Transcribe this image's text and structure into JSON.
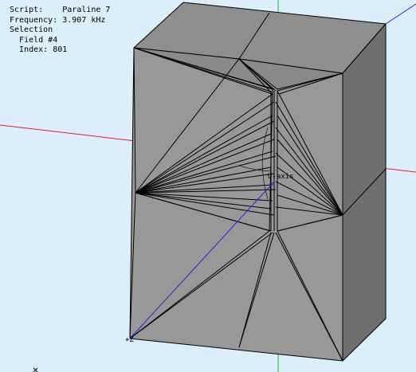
{
  "info": {
    "script_label": "Script:",
    "script_value": "Paraline 7",
    "frequency_label": "Frequency:",
    "frequency_value": "3.907 kHz",
    "selection_label": "Selection",
    "field_label": "Field #4",
    "index_label": "Index:",
    "index_value": "801"
  },
  "viewport": {
    "z_axis_label": "+Z",
    "u_axis_label": "U-axis"
  },
  "colors": {
    "background": "#dbeef9",
    "face_top": "#8e8e8e",
    "face_front": "#989898",
    "face_right": "#6f6f6f",
    "x_axis": "#e0202a",
    "y_axis": "#18c018",
    "z_axis": "#2626d8"
  }
}
